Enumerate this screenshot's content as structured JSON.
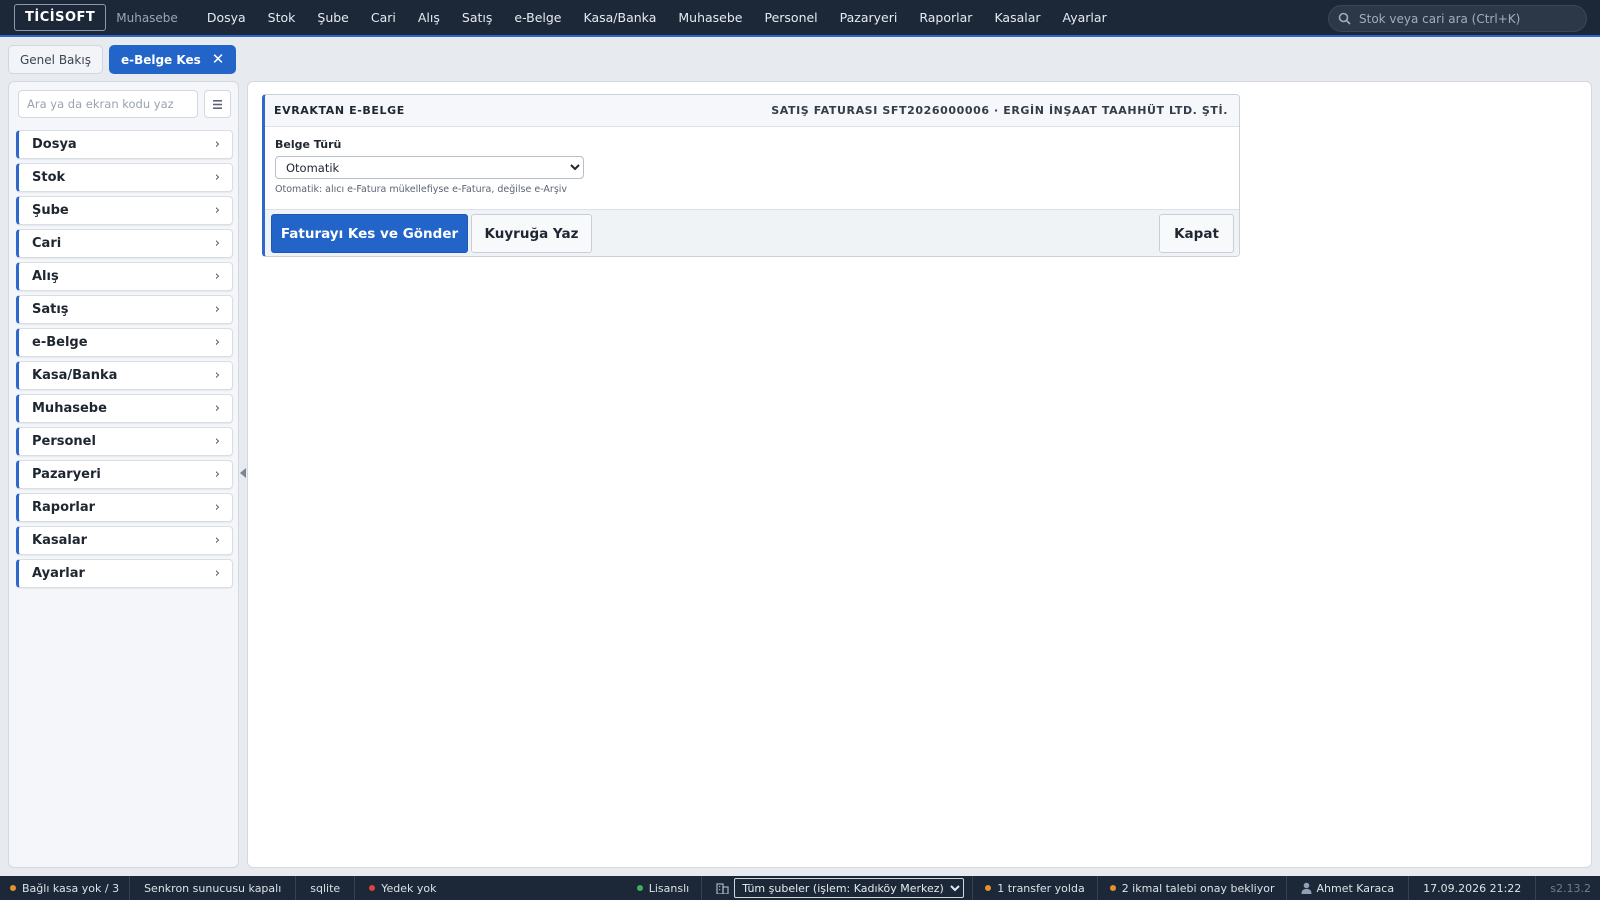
{
  "app": {
    "logo": "TİCİSOFT",
    "module": "Muhasebe"
  },
  "topnav": [
    "Dosya",
    "Stok",
    "Şube",
    "Cari",
    "Alış",
    "Satış",
    "e-Belge",
    "Kasa/Banka",
    "Muhasebe",
    "Personel",
    "Pazaryeri",
    "Raporlar",
    "Kasalar",
    "Ayarlar"
  ],
  "search": {
    "placeholder": "Stok veya cari ara (Ctrl+K)",
    "icon": "search-icon"
  },
  "tabs": [
    {
      "label": "Genel Bakış",
      "active": false
    },
    {
      "label": "e-Belge Kes",
      "active": true,
      "close": "✕"
    }
  ],
  "sidebar": {
    "search_placeholder": "Ara ya da ekran kodu yaz",
    "grid_icon": "grid-icon",
    "items": [
      {
        "label": "Dosya",
        "chevron": "›"
      },
      {
        "label": "Stok",
        "chevron": "›"
      },
      {
        "label": "Şube",
        "chevron": "›"
      },
      {
        "label": "Cari",
        "chevron": "›"
      },
      {
        "label": "Alış",
        "chevron": "›"
      },
      {
        "label": "Satış",
        "chevron": "›"
      },
      {
        "label": "e-Belge",
        "chevron": "›"
      },
      {
        "label": "Kasa/Banka",
        "chevron": "›"
      },
      {
        "label": "Muhasebe",
        "chevron": "›"
      },
      {
        "label": "Personel",
        "chevron": "›"
      },
      {
        "label": "Pazaryeri",
        "chevron": "›"
      },
      {
        "label": "Raporlar",
        "chevron": "›"
      },
      {
        "label": "Kasalar",
        "chevron": "›"
      },
      {
        "label": "Ayarlar",
        "chevron": "›"
      }
    ]
  },
  "panel": {
    "title": "EVRAKTAN E-BELGE",
    "meta": "SATIŞ FATURASI SFT2026000006 · ERGİN İNŞAAT TAAHHÜT LTD. ŞTİ.",
    "field_label": "Belge Türü",
    "select_value": "Otomatik",
    "hint": "Otomatik: alıcı e-Fatura mükellefiyse e-Fatura, değilse e-Arşiv",
    "buttons": {
      "primary": "Faturayı Kes ve Gönder",
      "secondary": "Kuyruğa Yaz",
      "close": "Kapat"
    }
  },
  "status": {
    "kasa": "Bağlı kasa yok / 3",
    "sync": "Senkron sunucusu kapalı",
    "db": "sqlite",
    "backup": "Yedek yok",
    "license": "Lisanslı",
    "branch_select": "Tüm şubeler (işlem: Kadıköy Merkez)",
    "transfer": "1 transfer yolda",
    "ikmal": "2 ikmal talebi onay bekliyor",
    "user": "Ahmet Karaca",
    "datetime": "17.09.2026 21:22",
    "version": "s2.13.2"
  },
  "colors": {
    "topbar": "#1c2838",
    "accent": "#2364c8",
    "status_warning": "#e8912b",
    "status_error": "#e0413b",
    "status_ok": "#3fb060"
  }
}
